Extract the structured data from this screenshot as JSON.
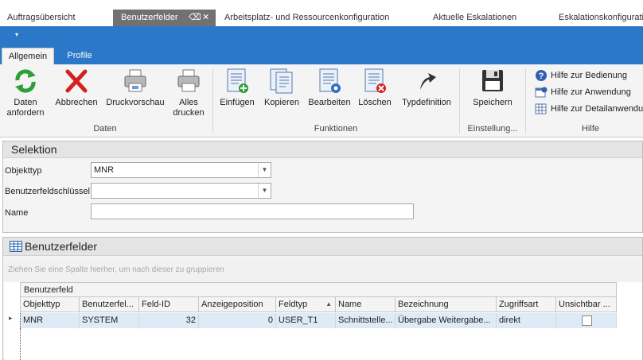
{
  "doc_tabs": {
    "tab1": "Auftragsübersicht",
    "tab2": "Benutzerfelder",
    "tab3": "Arbeitsplatz- und Ressourcenkonfiguration",
    "tab4": "Aktuelle Eskalationen",
    "tab5": "Eskalationskonfigurati"
  },
  "qat": {
    "menu_glyph": "▾"
  },
  "ribbon_tabs": {
    "general": "Allgemein",
    "profiles": "Profile"
  },
  "ribbon": {
    "data_request": "Daten anfordern",
    "cancel": "Abbrechen",
    "print_preview": "Druckvorschau",
    "print_all": "Alles drucken",
    "group_data": "Daten",
    "insert": "Einfügen",
    "copy": "Kopieren",
    "edit": "Bearbeiten",
    "delete": "Löschen",
    "type_definition": "Typdefinition",
    "group_functions": "Funktionen",
    "save": "Speichern",
    "group_settings": "Einstellung...",
    "help_operation": "Hilfe zur Bedienung",
    "help_application": "Hilfe zur Anwendung",
    "help_detail": "Hilfe zur Detailanwendun",
    "group_help": "Hilfe"
  },
  "selection": {
    "title": "Selektion",
    "object_type_label": "Objekttyp",
    "object_type_value": "MNR",
    "key_label": "Benutzerfeldschlüssel",
    "key_value": "",
    "name_label": "Name",
    "name_value": ""
  },
  "grid": {
    "title": "Benutzerfelder",
    "group_hint": "Ziehen Sie eine Spalte hierher, um nach dieser zu gruppieren",
    "band": "Benutzerfeld",
    "columns": [
      "Objekttyp",
      "Benutzerfel...",
      "Feld-ID",
      "Anzeigeposition",
      "Feldtyp",
      "Name",
      "Bezeichnung",
      "Zugriffsart",
      "Unsichtbar ..."
    ],
    "sort_glyph": "▲",
    "row_indicator": "▸",
    "rows": [
      [
        "MNR",
        "SYSTEM",
        "32",
        "0",
        "USER_T1",
        "Schnittstelle...",
        "Übergabe Weitergabe...",
        "direkt",
        ""
      ]
    ]
  },
  "colors": {
    "accent_blue": "#2b78c8",
    "active_doc_tab": "#717171",
    "selected_row": "#deeaf6"
  }
}
